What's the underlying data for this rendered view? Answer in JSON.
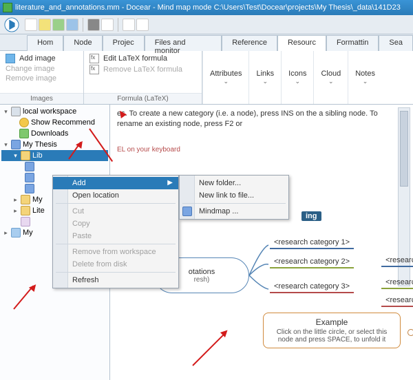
{
  "title": "literature_and_annotations.mm - Docear - Mind map mode C:\\Users\\Test\\Docear\\projects\\My Thesis\\_data\\141D23",
  "menu": {
    "home": "Hom",
    "node": "Node",
    "project": "Projec",
    "files": "Files and monitor",
    "reference": "Reference",
    "resource": "Resourc",
    "formatting": "Formattin",
    "search": "Sea"
  },
  "ribbon": {
    "images": {
      "add": "Add image",
      "change": "Change image",
      "remove": "Remove image",
      "label": "Images"
    },
    "formula": {
      "edit": "Edit LaTeX formula",
      "remove": "Remove LaTeX formula",
      "label": "Formula (LaTeX)"
    },
    "attrs": "Attributes",
    "links": "Links",
    "icons": "Icons",
    "cloud": "Cloud",
    "notes": "Notes"
  },
  "sidebar": {
    "root": "local workspace",
    "show_rec": "Show Recommend",
    "downloads": "Downloads",
    "my_thesis": "My Thesis",
    "lib": "Lib",
    "my": "My",
    "lite": "Lite",
    "my2": "My"
  },
  "canvas": {
    "hint": "es. To create a new category (i.e. a node), press INS on the a sibling node. To rename an existing node, press F2 or",
    "hint2": "EL on your keyboard",
    "root_line1": "otations",
    "root_line2": "resh)",
    "cat1": "<research category 1>",
    "cat2": "<research category 2>",
    "cat3": "<research category 3>",
    "catR1": "<research ca",
    "catR2": "<research ca",
    "catR3": "<research ca",
    "ing": "ing",
    "example_t": "Example",
    "example_s": "Click on the little circle, or select this node and press SPACE, to unfold it"
  },
  "ctx": {
    "add": "Add",
    "open_loc": "Open location",
    "cut": "Cut",
    "copy": "Copy",
    "paste": "Paste",
    "remove_ws": "Remove from workspace",
    "delete_disk": "Delete from disk",
    "refresh": "Refresh",
    "new_folder": "New folder...",
    "new_link": "New link to file...",
    "mindmap": "Mindmap ..."
  }
}
